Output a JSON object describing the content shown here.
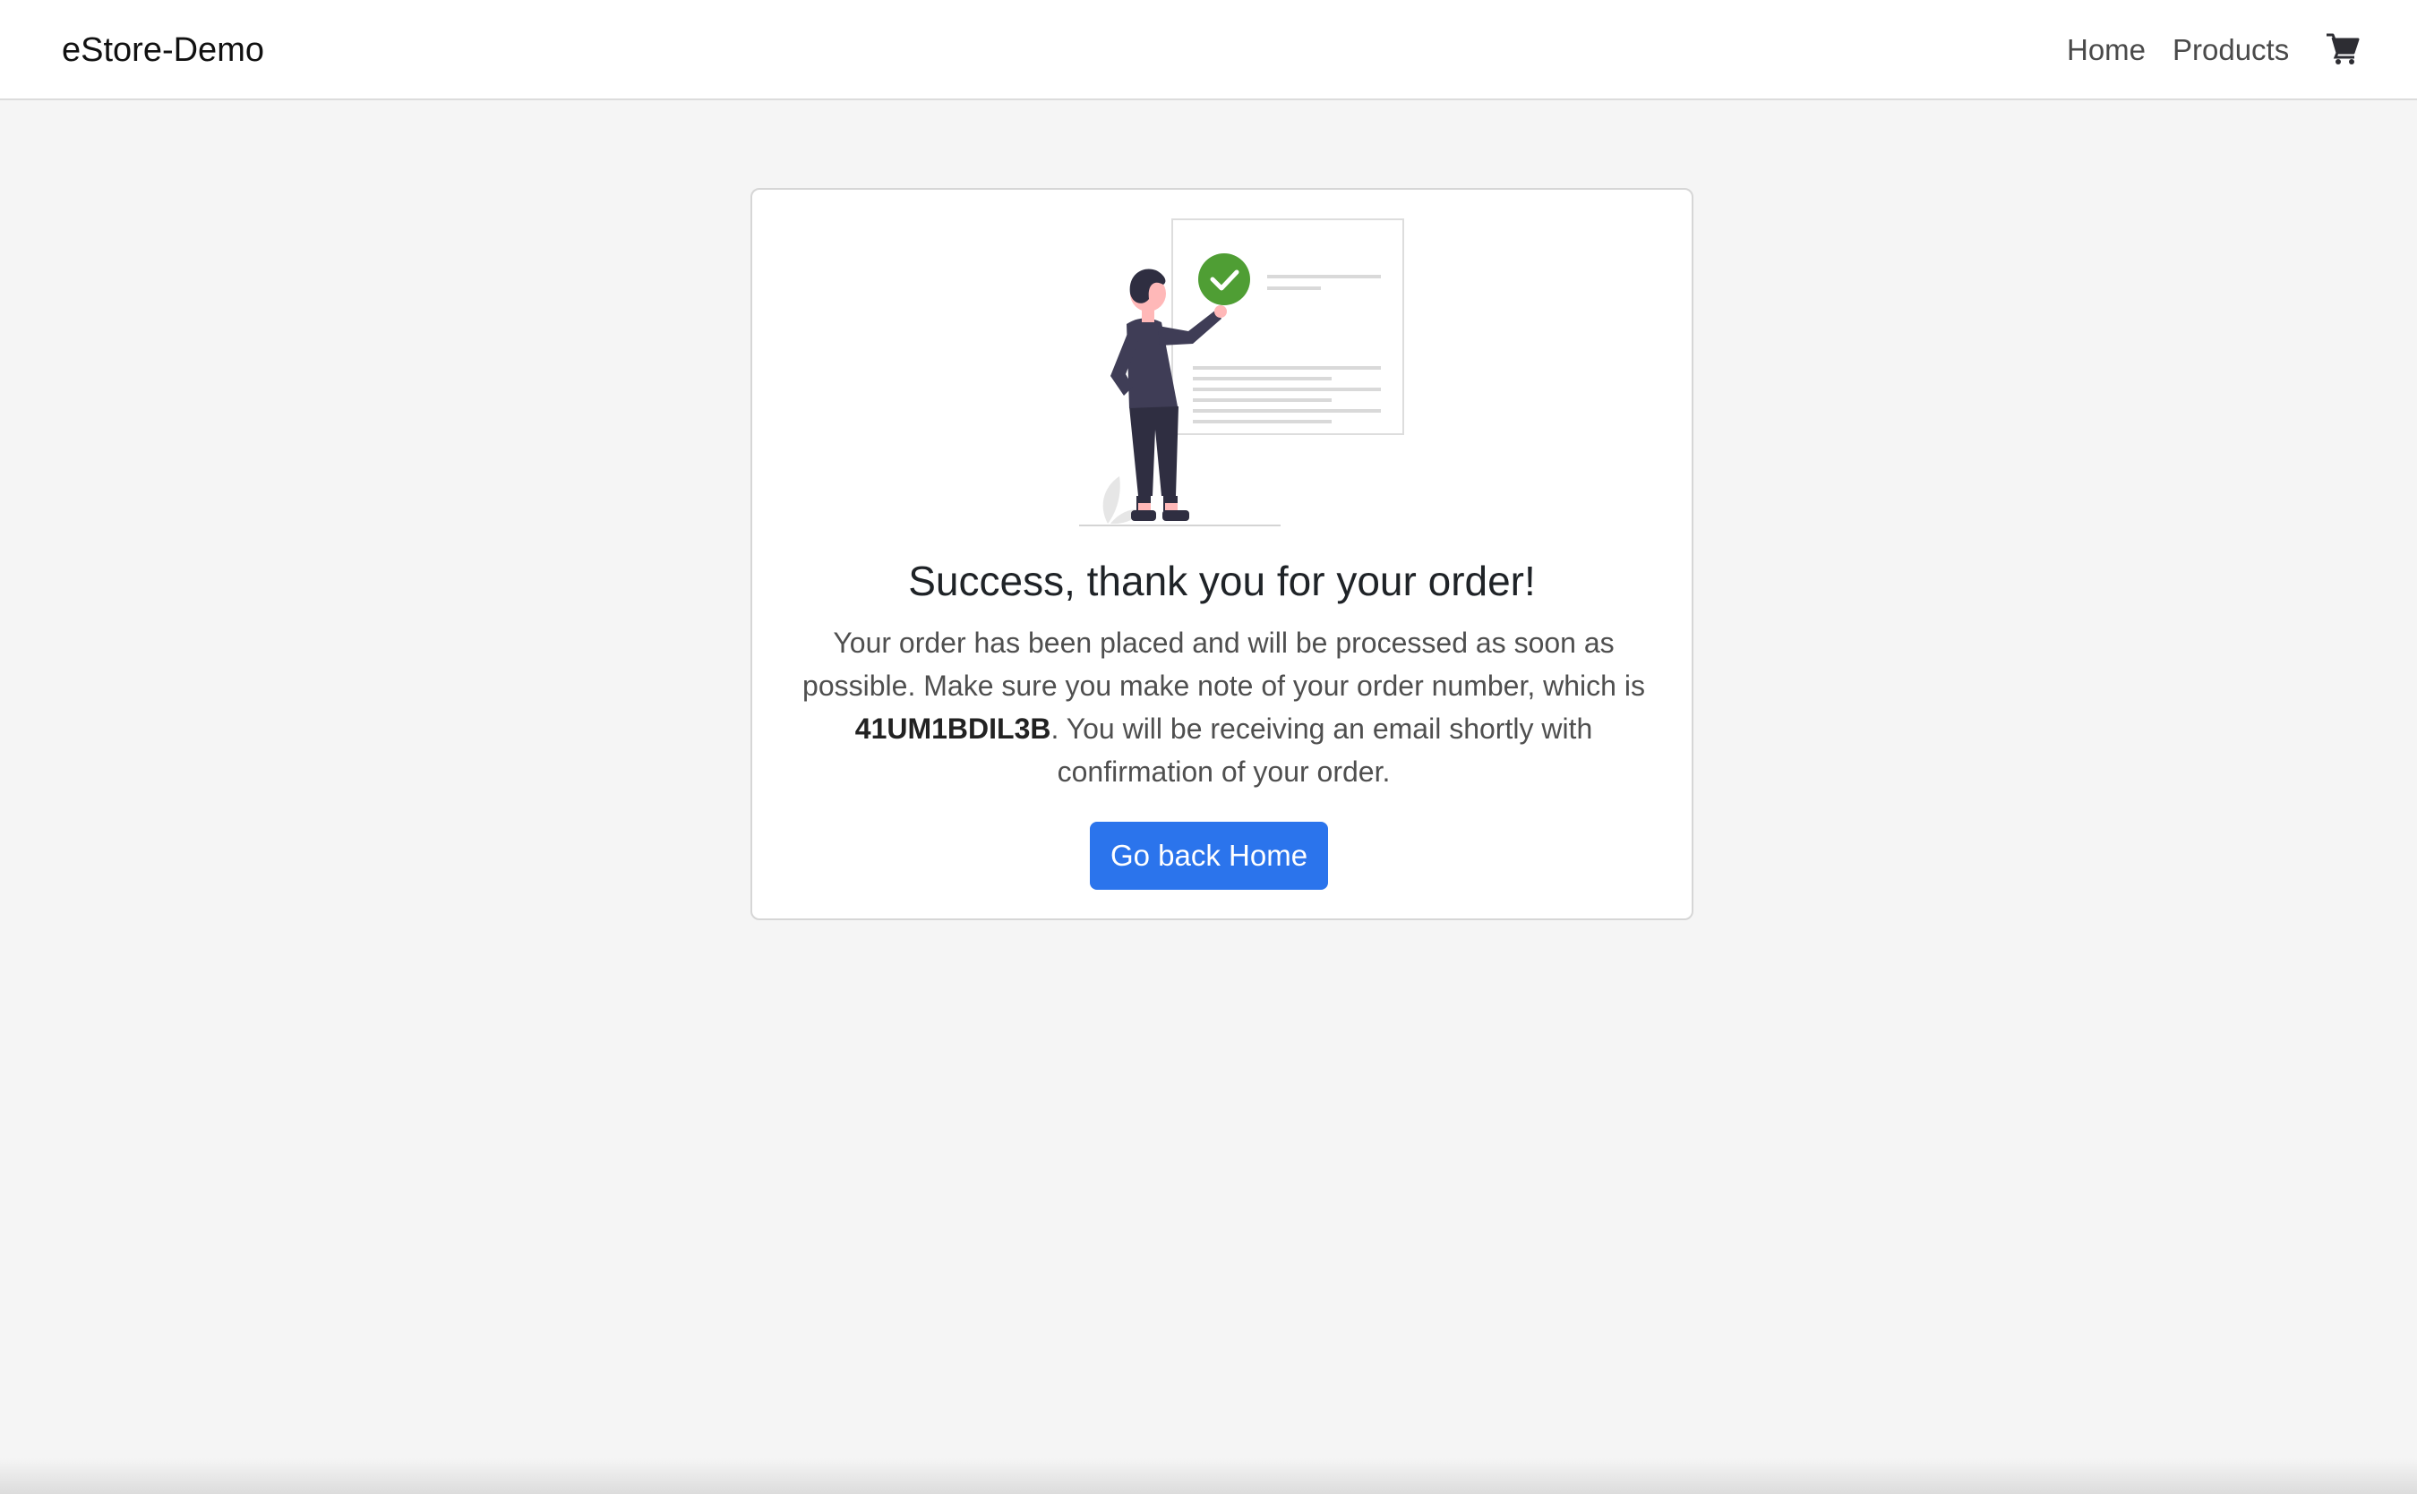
{
  "navbar": {
    "brand": "eStore-Demo",
    "links": [
      {
        "label": "Home"
      },
      {
        "label": "Products"
      }
    ],
    "cart_icon": "shopping-cart-icon"
  },
  "confirmation": {
    "illustration_icon": "order-success-illustration",
    "title": "Success, thank you for your order!",
    "message_part1": "Your order has been placed and will be processed as soon as possible. Make sure you make note of your order number, which is ",
    "order_number": "41UM1BDIL3B",
    "message_part2": ". You will be receiving an email shortly with confirmation of your order.",
    "button_label": "Go back Home"
  },
  "colors": {
    "accent": "#2b74ec",
    "success": "#4f9e34",
    "background": "#f5f5f5"
  }
}
